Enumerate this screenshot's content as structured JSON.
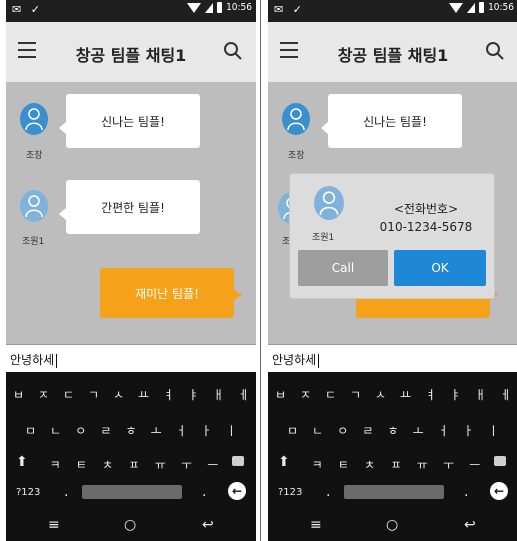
{
  "status": {
    "time": "10:56",
    "left_icons": "✉ ✓"
  },
  "appbar": {
    "title": "창공 팀플 채팅1"
  },
  "messages": [
    {
      "user": "조장",
      "text": "신나는 팀플!"
    },
    {
      "user": "조원1",
      "text": "간편한 팀플!"
    },
    {
      "mine": true,
      "text": "재미난 팀플!"
    }
  ],
  "input": {
    "value": "안녕하세"
  },
  "keyboard": {
    "row1": [
      "ㅂ",
      "ㅈ",
      "ㄷ",
      "ㄱ",
      "ㅅ",
      "ㅛ",
      "ㅕ",
      "ㅑ",
      "ㅐ",
      "ㅔ"
    ],
    "row2": [
      "ㅁ",
      "ㄴ",
      "ㅇ",
      "ㄹ",
      "ㅎ",
      "ㅗ",
      "ㅓ",
      "ㅏ",
      "ㅣ"
    ],
    "row3": [
      "ㅋ",
      "ㅌ",
      "ㅊ",
      "ㅍ",
      "ㅠ",
      "ㅜ",
      "ㅡ"
    ],
    "num_label": "?123",
    "period": ".",
    "nav": {
      "menu": "≡",
      "home": "○",
      "back": "↩"
    }
  },
  "dialog": {
    "user": "조원1",
    "label": "<전화번호>",
    "phone": "010-1234-5678",
    "call": "Call",
    "ok": "OK"
  },
  "icons": [
    "hamburger-icon",
    "search-icon",
    "avatar-icon",
    "shift-icon",
    "backspace-icon",
    "enter-icon"
  ],
  "colors": {
    "accent": "#1e88d6",
    "orange": "#f6a11a"
  }
}
